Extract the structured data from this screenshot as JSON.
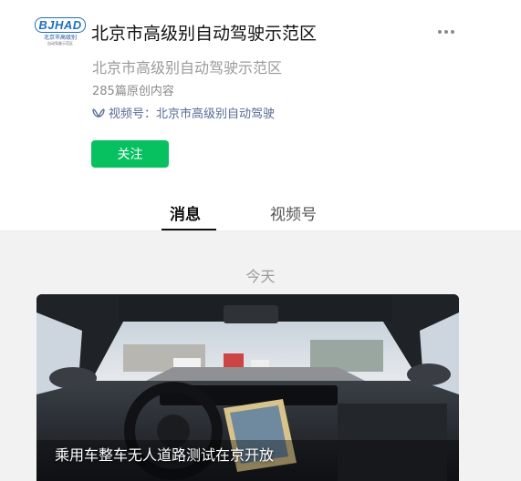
{
  "account": {
    "logo_text": "BJHAD",
    "logo_sub1": "北京市高级别",
    "logo_sub2": "自动驾驶示范区",
    "name": "北京市高级别自动驾驶示范区",
    "description": "北京市高级别自动驾驶示范区",
    "article_count": "285篇原创内容",
    "video_channel": "视频号：北京市高级别自动驾驶",
    "follow_label": "关注",
    "more_icon": "more-dots-icon",
    "channel_icon": "video-channel-icon"
  },
  "tabs": [
    {
      "label": "消息",
      "active": true
    },
    {
      "label": "视频号",
      "active": false
    }
  ],
  "feed": {
    "date_label": "今天",
    "articles": [
      {
        "title": "乘用车整车无人道路测试在京开放"
      }
    ]
  },
  "colors": {
    "follow_button": "#07c160",
    "channel_link": "#576b95",
    "feed_background": "#f2f2f2"
  }
}
